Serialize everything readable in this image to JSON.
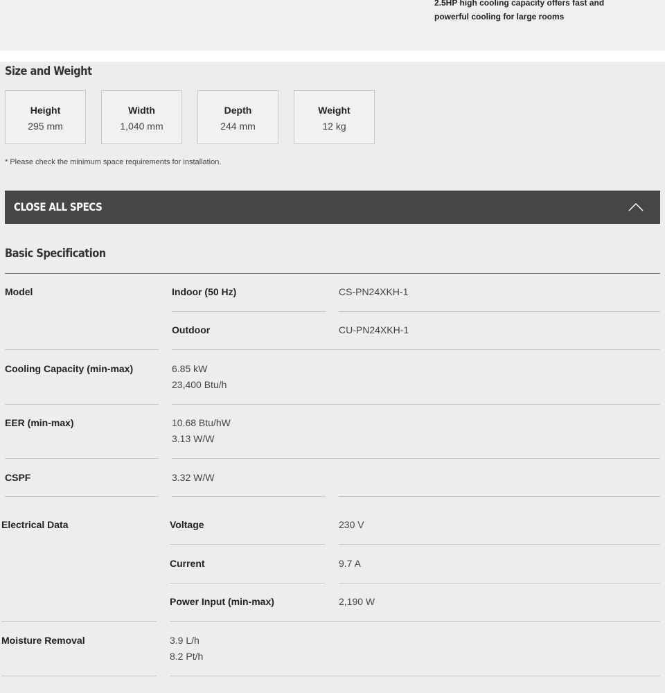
{
  "banner": {
    "line1": "2.5HP high cooling capacity offers fast and",
    "line2": "powerful cooling for large rooms"
  },
  "size_weight": {
    "title": "Size and Weight",
    "cards": [
      {
        "label": "Height",
        "value": "295 mm"
      },
      {
        "label": "Width",
        "value": "1,040 mm"
      },
      {
        "label": "Depth",
        "value": "244 mm"
      },
      {
        "label": "Weight",
        "value": "12 kg"
      }
    ],
    "note": "* Please check the minimum space requirements for installation."
  },
  "specs_toggle": {
    "label": "CLOSE ALL SPECS",
    "icon": "chevron-up-icon"
  },
  "basic_spec": {
    "title": "Basic Specification",
    "model": {
      "label": "Model",
      "indoor_label": "Indoor (50 Hz)",
      "indoor_value": "CS-PN24XKH-1",
      "outdoor_label": "Outdoor",
      "outdoor_value": "CU-PN24XKH-1"
    },
    "cooling_capacity": {
      "label": "Cooling Capacity (min-max)",
      "value1": "6.85 kW",
      "value2": "23,400 Btu/h"
    },
    "eer": {
      "label": "EER (min-max)",
      "value1": "10.68 Btu/hW",
      "value2": "3.13 W/W"
    },
    "cspf": {
      "label": "CSPF",
      "value": "3.32 W/W"
    },
    "electrical": {
      "label": "Electrical Data",
      "voltage_label": "Voltage",
      "voltage_value": "230 V",
      "current_label": "Current",
      "current_value": "9.7 A",
      "power_label": "Power Input (min-max)",
      "power_value": "2,190 W"
    },
    "moisture": {
      "label": "Moisture Removal",
      "value1": "3.9 L/h",
      "value2": "8.2 Pt/h"
    }
  }
}
